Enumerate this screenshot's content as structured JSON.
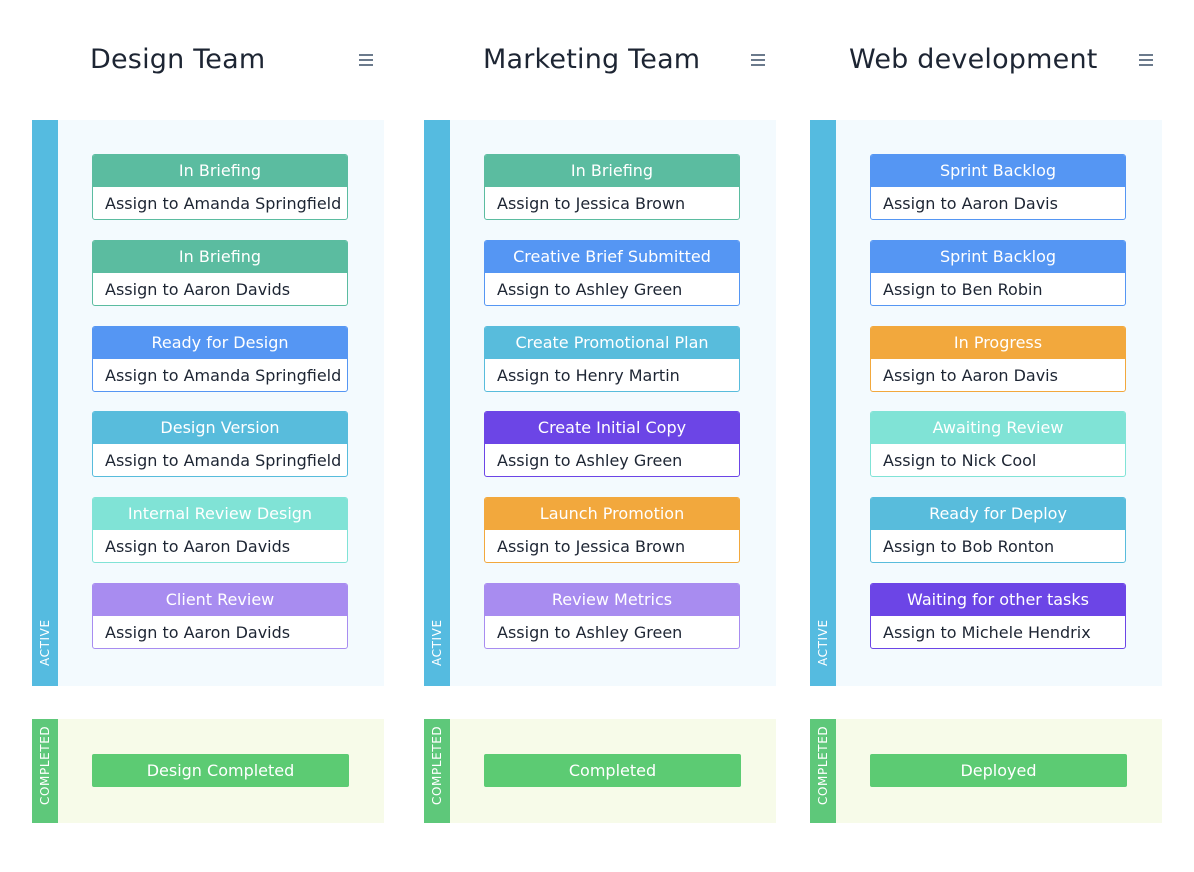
{
  "colors": {
    "green": "#5bbca0",
    "blue": "#5596f3",
    "sky": "#58bcdc",
    "mint": "#80e3d6",
    "lavender": "#a88cf0",
    "purple": "#6c45e6",
    "orange": "#f2a83d",
    "completed": "#5ccb73",
    "active_strip": "#55bbe0",
    "completed_strip": "#5ec87a"
  },
  "sections": {
    "active_label": "ACTIVE",
    "completed_label": "COMPLETED"
  },
  "columns": [
    {
      "title": "Design Team",
      "menu_icon": "hamburger-menu-icon",
      "cards": [
        {
          "status": "In Briefing",
          "assignee": "Assign to Amanda Springfield",
          "color": "green"
        },
        {
          "status": "In Briefing",
          "assignee": "Assign to Aaron Davids",
          "color": "green"
        },
        {
          "status": "Ready for Design",
          "assignee": "Assign to Amanda Springfield",
          "color": "blue"
        },
        {
          "status": "Design Version",
          "assignee": "Assign to Amanda Springfield",
          "color": "sky"
        },
        {
          "status": "Internal Review Design",
          "assignee": "Assign to Aaron Davids",
          "color": "mint"
        },
        {
          "status": "Client Review",
          "assignee": "Assign to Aaron Davids",
          "color": "lavender"
        }
      ],
      "completed": "Design Completed"
    },
    {
      "title": "Marketing Team",
      "menu_icon": "hamburger-menu-icon",
      "cards": [
        {
          "status": "In Briefing",
          "assignee": "Assign to Jessica Brown",
          "color": "green"
        },
        {
          "status": "Creative Brief Submitted",
          "assignee": "Assign to Ashley Green",
          "color": "blue"
        },
        {
          "status": "Create Promotional Plan",
          "assignee": "Assign to Henry Martin",
          "color": "sky"
        },
        {
          "status": "Create Initial Copy",
          "assignee": "Assign to Ashley Green",
          "color": "purple"
        },
        {
          "status": "Launch Promotion",
          "assignee": "Assign to Jessica Brown",
          "color": "orange"
        },
        {
          "status": "Review Metrics",
          "assignee": "Assign to Ashley Green",
          "color": "lavender"
        }
      ],
      "completed": "Completed"
    },
    {
      "title": "Web development",
      "menu_icon": "hamburger-menu-icon",
      "cards": [
        {
          "status": "Sprint Backlog",
          "assignee": "Assign to Aaron Davis",
          "color": "blue"
        },
        {
          "status": "Sprint Backlog",
          "assignee": "Assign to Ben Robin",
          "color": "blue"
        },
        {
          "status": "In Progress",
          "assignee": "Assign to Aaron Davis",
          "color": "orange"
        },
        {
          "status": "Awaiting Review",
          "assignee": "Assign to Nick Cool",
          "color": "mint"
        },
        {
          "status": "Ready for Deploy",
          "assignee": "Assign to Bob Ronton",
          "color": "sky"
        },
        {
          "status": "Waiting for other tasks",
          "assignee": "Assign to Michele Hendrix",
          "color": "purple"
        }
      ],
      "completed": "Deployed"
    }
  ]
}
